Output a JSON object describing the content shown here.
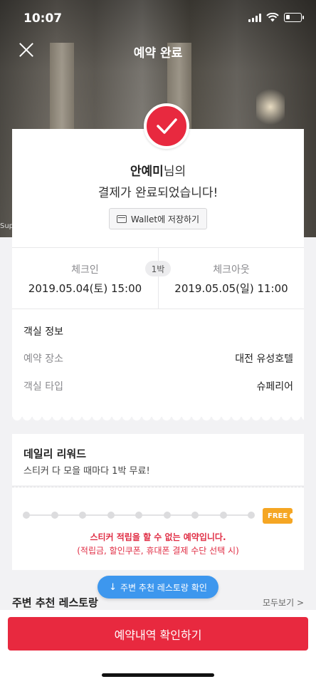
{
  "status_bar": {
    "time": "10:07"
  },
  "nav": {
    "title": "예약 완료"
  },
  "hero": {
    "caption": "Super"
  },
  "greeting": {
    "name": "안예미",
    "name_suffix": "님의",
    "message": "결제가 완료되었습니다!"
  },
  "wallet": {
    "label": "Wallet에 저장하기"
  },
  "stay": {
    "checkin_label": "체크인",
    "checkin_value": "2019.05.04(토) 15:00",
    "nights": "1박",
    "checkout_label": "체크아웃",
    "checkout_value": "2019.05.05(일) 11:00"
  },
  "room": {
    "title": "객실 정보",
    "rows": [
      {
        "label": "예약 장소",
        "value": "대전 유성호텔"
      },
      {
        "label": "객실 타입",
        "value": "슈페리어"
      }
    ]
  },
  "reward": {
    "title": "데일리 리워드",
    "subtitle": "스티커 다 모을 때마다 1박 무료!",
    "free_tag": "FREE",
    "total_dots": 9,
    "warning": "스티커 적립을 할 수 없는 예약입니다.",
    "warning_detail": "(적립금, 할인쿠폰, 휴대폰 결제 수단 선택 시)"
  },
  "nearby": {
    "pill_label": "주변 추천 레스토랑 확인",
    "title": "주변 추천 레스토랑",
    "see_all": "모두보기 >"
  },
  "confirm_button": "예약내역 확인하기",
  "colors": {
    "accent": "#e8293f",
    "blue": "#3d97ee",
    "free": "#f5a623"
  }
}
